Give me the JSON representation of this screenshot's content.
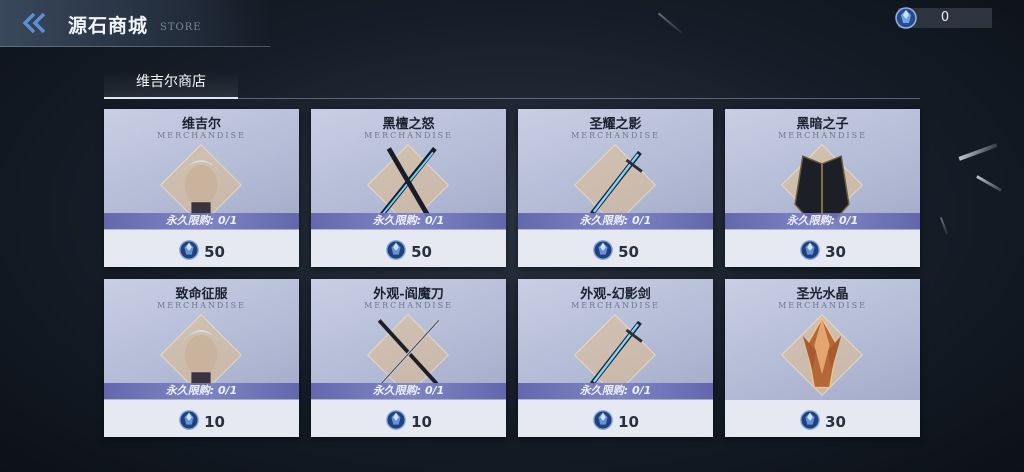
{
  "header": {
    "title": "源石商城",
    "subtitle": "STORE",
    "currency_value": "0"
  },
  "tabs": [
    {
      "label": "维吉尔商店",
      "active": true
    }
  ],
  "colors": {
    "accent": "#5b8fd6",
    "card_bg": "#b9c0da",
    "limit_bar": "#6a70b8"
  },
  "items": [
    {
      "name": "维吉尔",
      "tag": "MERCHANDISE",
      "limit": "永久限购: 0/1",
      "price": "50",
      "art": "portrait-icon"
    },
    {
      "name": "黑檀之怒",
      "tag": "MERCHANDISE",
      "limit": "永久限购: 0/1",
      "price": "50",
      "art": "twin-blades-icon"
    },
    {
      "name": "圣耀之影",
      "tag": "MERCHANDISE",
      "limit": "永久限购: 0/1",
      "price": "50",
      "art": "sword-icon"
    },
    {
      "name": "黑暗之子",
      "tag": "MERCHANDISE",
      "limit": "永久限购: 0/1",
      "price": "30",
      "art": "coat-icon"
    },
    {
      "name": "致命征服",
      "tag": "MERCHANDISE",
      "limit": "永久限购: 0/1",
      "price": "10",
      "art": "portrait-icon"
    },
    {
      "name": "外观-阎魔刀",
      "tag": "MERCHANDISE",
      "limit": "永久限购: 0/1",
      "price": "10",
      "art": "katana-icon"
    },
    {
      "name": "外观-幻影剑",
      "tag": "MERCHANDISE",
      "limit": "永久限购: 0/1",
      "price": "10",
      "art": "sword-icon"
    },
    {
      "name": "圣光水晶",
      "tag": "MERCHANDISE",
      "limit": "",
      "price": "30",
      "art": "crystal-icon"
    }
  ]
}
